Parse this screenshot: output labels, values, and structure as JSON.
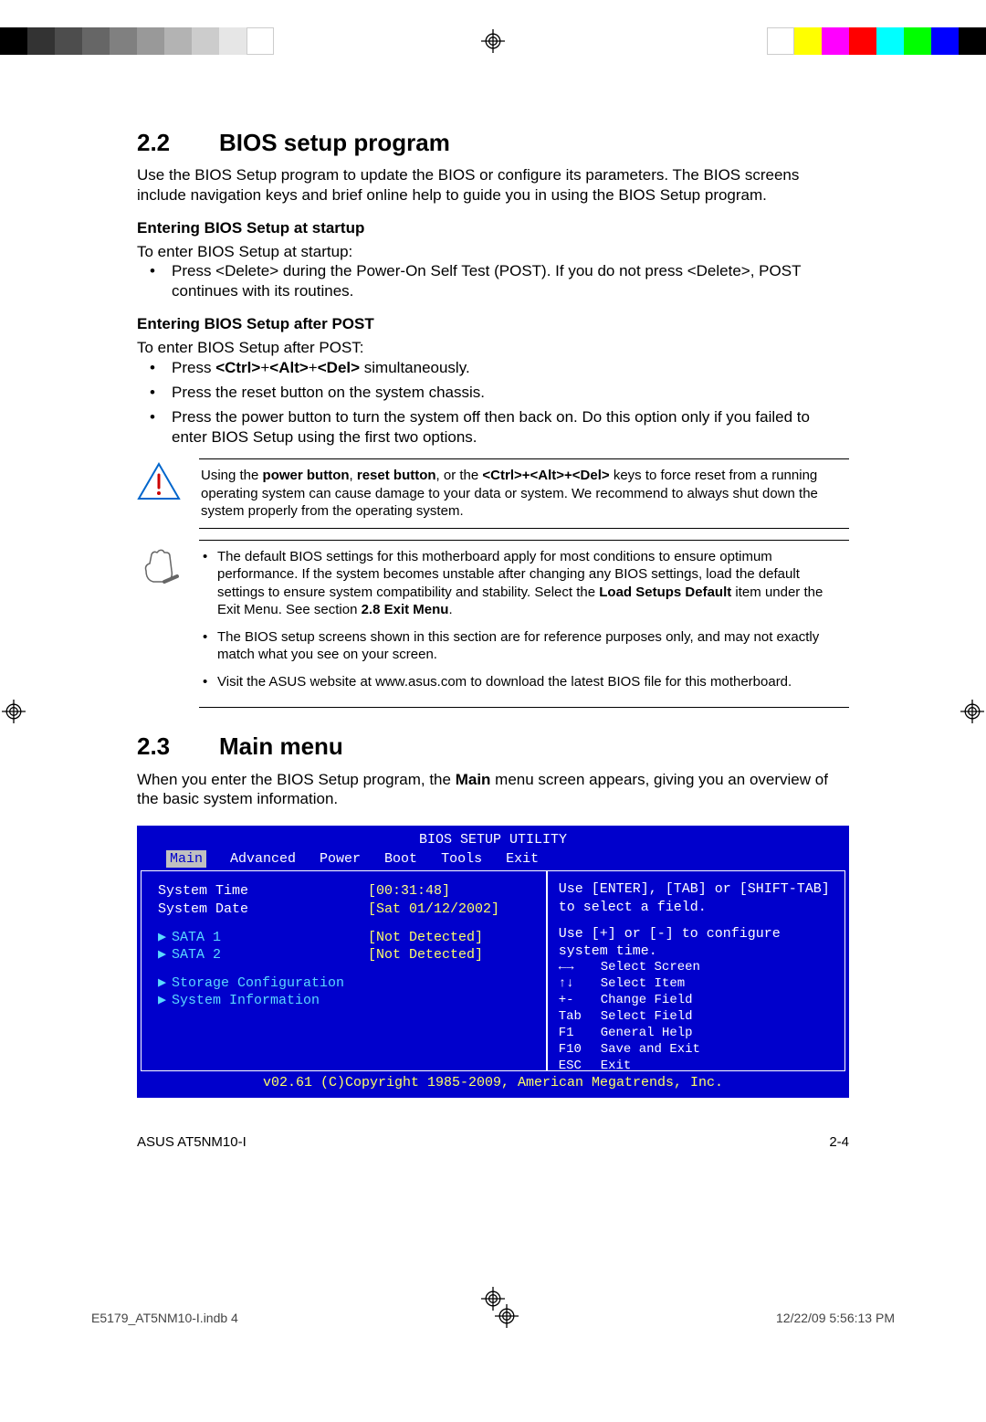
{
  "colorbar_left": [
    "#000",
    "#333",
    "#4d4d4d",
    "#666",
    "#808080",
    "#999",
    "#b3b3b3",
    "#ccc",
    "#e6e6e6",
    "#fff"
  ],
  "colorbar_right": [
    "#fff",
    "#ffff00",
    "#ff00ff",
    "#ff0000",
    "#00ffff",
    "#00ff00",
    "#0000ff",
    "#000"
  ],
  "section22": {
    "num": "2.2",
    "title": "BIOS setup program",
    "intro": "Use the BIOS Setup program to update the BIOS or configure its parameters. The BIOS screens include navigation keys and brief online help to guide you in using the BIOS Setup program.",
    "sub1_title": "Entering BIOS Setup at startup",
    "sub1_lead": "To enter BIOS Setup at startup:",
    "sub1_bullet": "Press <Delete> during the Power-On Self Test (POST). If you do not press <Delete>, POST continues with its routines.",
    "sub2_title": "Entering BIOS Setup after POST",
    "sub2_lead": "To enter BIOS Setup after POST:",
    "sub2_bullets": [
      "Press <Ctrl>+<Alt>+<Del> simultaneously.",
      "Press the reset button on the system chassis.",
      "Press the power button to turn the system off then back on. Do this option only if you failed to enter BIOS Setup using the first two options."
    ]
  },
  "warning_note": {
    "pre": "Using the ",
    "bold1": "power button",
    "mid1": ", ",
    "bold2": "reset button",
    "mid2": ", or the ",
    "bold3": "<Ctrl>+<Alt>+<Del>",
    "post": " keys to force reset from a running operating system can cause damage to your data or system. We recommend to always shut down the system properly from the operating system."
  },
  "info_note": {
    "items": [
      {
        "t1": "The default BIOS settings for this motherboard apply for most conditions to ensure optimum performance. If the system becomes unstable after changing any BIOS settings, load the default settings to ensure system compatibility and stability. Select the ",
        "b": "Load Setups Default",
        "t2": " item under the Exit Menu. See section ",
        "b2": "2.8 Exit Menu",
        "t3": "."
      },
      {
        "t1": "The BIOS setup screens shown in this section are for reference purposes only, and may not exactly match what you see on your screen.",
        "b": "",
        "t2": "",
        "b2": "",
        "t3": ""
      },
      {
        "t1": "Visit the ASUS website at www.asus.com to download the latest BIOS file for this motherboard.",
        "b": "",
        "t2": "",
        "b2": "",
        "t3": ""
      }
    ]
  },
  "section23": {
    "num": "2.3",
    "title": "Main menu",
    "intro_pre": "When you enter the BIOS Setup program, the ",
    "intro_bold": "Main",
    "intro_post": " menu screen appears, giving you an overview of the basic system information."
  },
  "bios": {
    "header": "BIOS SETUP UTILITY",
    "tabs": [
      "Main",
      "Advanced",
      "Power",
      "Boot",
      "Tools",
      "Exit"
    ],
    "rows": [
      {
        "lbl": "System Time",
        "val": "[00:31:48]",
        "sel": true
      },
      {
        "lbl": "System Date",
        "val": "[Sat 01/12/2002]",
        "sel": false
      }
    ],
    "sata": [
      {
        "lbl": "SATA 1",
        "val": "[Not Detected]"
      },
      {
        "lbl": "SATA 2",
        "val": "[Not Detected]"
      }
    ],
    "sub": [
      "Storage Configuration",
      "System Information"
    ],
    "help_top": "Use [ENTER], [TAB] or [SHIFT-TAB] to select a field.",
    "help_top2": "Use [+] or [-] to configure system time.",
    "keys": [
      {
        "k": "←→",
        "d": "Select Screen"
      },
      {
        "k": "↑↓",
        "d": "Select Item"
      },
      {
        "k": "+-",
        "d": "Change Field"
      },
      {
        "k": "Tab",
        "d": "Select Field"
      },
      {
        "k": "F1",
        "d": "General Help"
      },
      {
        "k": "F10",
        "d": "Save and Exit"
      },
      {
        "k": "ESC",
        "d": "Exit"
      }
    ],
    "footer": "v02.61 (C)Copyright 1985-2009, American Megatrends, Inc."
  },
  "footer_left": "ASUS AT5NM10-I",
  "footer_right": "2-4",
  "print_left": "E5179_AT5NM10-I.indb   4",
  "print_right": "12/22/09   5:56:13 PM"
}
